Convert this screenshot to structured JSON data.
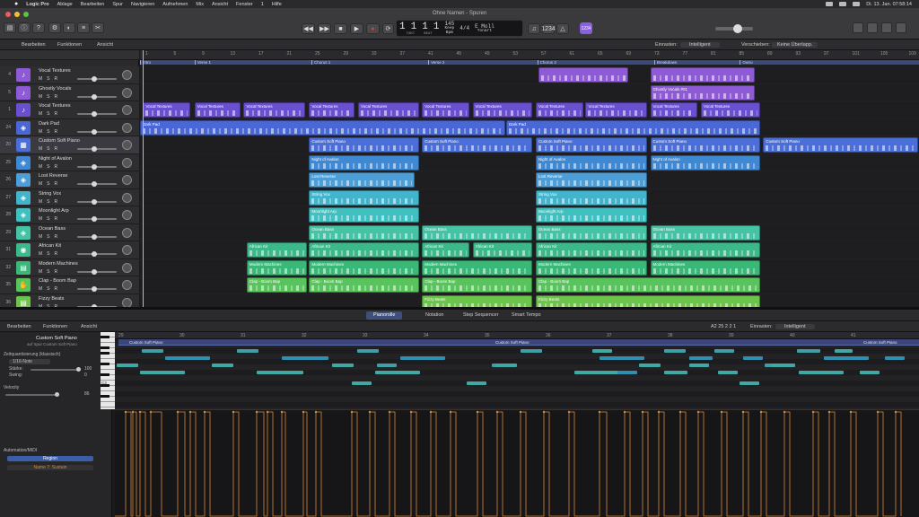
{
  "menubar": {
    "app": "Logic Pro",
    "items": [
      "Ablage",
      "Bearbeiten",
      "Spur",
      "Navigieren",
      "Aufnehmen",
      "Mix",
      "Ansicht",
      "Fenster",
      "1",
      "Hilfe"
    ],
    "clock": "Di. 13. Jan.  07:58:14"
  },
  "window": {
    "title": "Ohne Namen - Spuren"
  },
  "lcd": {
    "bar": "1",
    "beat": "1",
    "div": "1",
    "tick": "1",
    "bar_label": "TAKT",
    "beat_label": "BEAT",
    "tempo": "145",
    "tempo_label": "Bpm",
    "tempo_mode": "Keep",
    "signature": "4/4",
    "key": "E Moll",
    "key_label": "Tonart"
  },
  "smart_label": "1234",
  "arrange_bar": {
    "edit": "Bearbeiten",
    "functions": "Funktionen",
    "view": "Ansicht",
    "snap_label": "Einrasten:",
    "snap_value": "Intelligent",
    "drag_label": "Verschieben:",
    "drag_value": "Keine Überlapp."
  },
  "tracks": [
    {
      "num": "4",
      "name": "Vocal Textures",
      "color": "#8e5ad6",
      "icon": "♪"
    },
    {
      "num": "5",
      "name": "Ghostly Vocals",
      "color": "#8e5ad6",
      "icon": "♪"
    },
    {
      "num": "1",
      "name": "Vocal Textures",
      "color": "#6a4fd0",
      "icon": "♪"
    },
    {
      "num": "24",
      "name": "Dark Pad",
      "color": "#4a67d6",
      "icon": "◈"
    },
    {
      "num": "20",
      "name": "Custom Soft Piano",
      "color": "#4b6fd8",
      "icon": "▦"
    },
    {
      "num": "25",
      "name": "Night of Avalon",
      "color": "#3f88d4",
      "icon": "◈"
    },
    {
      "num": "26",
      "name": "Lost Reverse",
      "color": "#4d9ed6",
      "icon": "◈"
    },
    {
      "num": "27",
      "name": "String Vox",
      "color": "#42b4cc",
      "icon": "◈"
    },
    {
      "num": "28",
      "name": "Moonlight Arp",
      "color": "#40c0c0",
      "icon": "◈"
    },
    {
      "num": "29",
      "name": "Ocean Bass",
      "color": "#44c4a4",
      "icon": "◈"
    },
    {
      "num": "31",
      "name": "African Kit",
      "color": "#3cb88a",
      "icon": "◉"
    },
    {
      "num": "32",
      "name": "Modern Machines",
      "color": "#3ab878",
      "icon": "▤"
    },
    {
      "num": "35",
      "name": "Clap - Boom Bap",
      "color": "#58c45c",
      "icon": "✋"
    },
    {
      "num": "36",
      "name": "Fizzy Beats",
      "color": "#6cc44a",
      "icon": "▤"
    }
  ],
  "track_buttons": {
    "m": "M",
    "s": "S",
    "r": "R"
  },
  "ruler": [
    "1",
    "5",
    "9",
    "13",
    "17",
    "21",
    "25",
    "29",
    "33",
    "37",
    "41",
    "45",
    "49",
    "53",
    "57",
    "61",
    "65",
    "69",
    "73",
    "77",
    "81",
    "85",
    "89",
    "93",
    "97",
    "101",
    "105",
    "109"
  ],
  "markers": [
    {
      "label": "Intro",
      "start": 0.0,
      "end": 0.07
    },
    {
      "label": "Verse 1",
      "start": 0.07,
      "end": 0.22
    },
    {
      "label": "Chorus 1",
      "start": 0.22,
      "end": 0.37
    },
    {
      "label": "Verse 2",
      "start": 0.37,
      "end": 0.51
    },
    {
      "label": "Chorus 2",
      "start": 0.51,
      "end": 0.66
    },
    {
      "label": "Breakdown",
      "start": 0.66,
      "end": 0.77
    },
    {
      "label": "Outro",
      "start": 0.77,
      "end": 1.0
    }
  ],
  "regions": [
    {
      "lane": 0,
      "label": "",
      "start": 0.511,
      "end": 0.628
    },
    {
      "lane": 0,
      "label": "",
      "start": 0.655,
      "end": 0.79
    },
    {
      "lane": 1,
      "label": "Ghostly Vocals #01",
      "start": 0.655,
      "end": 0.79
    },
    {
      "lane": 2,
      "label": "Vocal Textures",
      "start": 0.004,
      "end": 0.066
    },
    {
      "lane": 2,
      "label": "Vocal Textures",
      "start": 0.07,
      "end": 0.13
    },
    {
      "lane": 2,
      "label": "Vocal Textures",
      "start": 0.133,
      "end": 0.213
    },
    {
      "lane": 2,
      "label": "Vocal Textures",
      "start": 0.217,
      "end": 0.276
    },
    {
      "lane": 2,
      "label": "Vocal Textures",
      "start": 0.28,
      "end": 0.36
    },
    {
      "lane": 2,
      "label": "Vocal Textures",
      "start": 0.362,
      "end": 0.424
    },
    {
      "lane": 2,
      "label": "Vocal Textures",
      "start": 0.427,
      "end": 0.505
    },
    {
      "lane": 2,
      "label": "Vocal Textures",
      "start": 0.508,
      "end": 0.57
    },
    {
      "lane": 2,
      "label": "Vocal Textures",
      "start": 0.572,
      "end": 0.652
    },
    {
      "lane": 2,
      "label": "Vocal Textures",
      "start": 0.655,
      "end": 0.717
    },
    {
      "lane": 2,
      "label": "Vocal Textures",
      "start": 0.72,
      "end": 0.797
    },
    {
      "lane": 3,
      "label": "Dark Pad",
      "start": 0.0,
      "end": 0.47
    },
    {
      "lane": 3,
      "label": "Dark Pad",
      "start": 0.47,
      "end": 0.797
    },
    {
      "lane": 4,
      "label": "Custom Soft Piano",
      "start": 0.217,
      "end": 0.36
    },
    {
      "lane": 4,
      "label": "Custom Soft Piano",
      "start": 0.362,
      "end": 0.505
    },
    {
      "lane": 4,
      "label": "Custom Soft Piano",
      "start": 0.508,
      "end": 0.652
    },
    {
      "lane": 4,
      "label": "Custom Soft Piano",
      "start": 0.655,
      "end": 0.797
    },
    {
      "lane": 4,
      "label": "Custom Soft Piano",
      "start": 0.8,
      "end": 1.0
    },
    {
      "lane": 5,
      "label": "Night of Avalon",
      "start": 0.217,
      "end": 0.36
    },
    {
      "lane": 5,
      "label": "Night of Avalon",
      "start": 0.508,
      "end": 0.652
    },
    {
      "lane": 5,
      "label": "Night of Avalon",
      "start": 0.655,
      "end": 0.797
    },
    {
      "lane": 6,
      "label": "Lost Reverse",
      "start": 0.217,
      "end": 0.354
    },
    {
      "lane": 6,
      "label": "Lost Reverse",
      "start": 0.508,
      "end": 0.652
    },
    {
      "lane": 7,
      "label": "String Vox",
      "start": 0.217,
      "end": 0.36
    },
    {
      "lane": 7,
      "label": "String Vox",
      "start": 0.508,
      "end": 0.652
    },
    {
      "lane": 8,
      "label": "Moonlight Arp",
      "start": 0.217,
      "end": 0.36
    },
    {
      "lane": 8,
      "label": "Moonlight Arp",
      "start": 0.508,
      "end": 0.652
    },
    {
      "lane": 9,
      "label": "Ocean Bass",
      "start": 0.217,
      "end": 0.36
    },
    {
      "lane": 9,
      "label": "Ocean Bass",
      "start": 0.362,
      "end": 0.505
    },
    {
      "lane": 9,
      "label": "Ocean Bass",
      "start": 0.508,
      "end": 0.652
    },
    {
      "lane": 9,
      "label": "Ocean Bass",
      "start": 0.655,
      "end": 0.797
    },
    {
      "lane": 10,
      "label": "African Kit",
      "start": 0.137,
      "end": 0.215
    },
    {
      "lane": 10,
      "label": "African Kit",
      "start": 0.217,
      "end": 0.36
    },
    {
      "lane": 10,
      "label": "African Kit",
      "start": 0.362,
      "end": 0.424
    },
    {
      "lane": 10,
      "label": "African Kit",
      "start": 0.427,
      "end": 0.505
    },
    {
      "lane": 10,
      "label": "African Kit",
      "start": 0.508,
      "end": 0.652
    },
    {
      "lane": 10,
      "label": "African Kit",
      "start": 0.655,
      "end": 0.797
    },
    {
      "lane": 11,
      "label": "Modern Machines",
      "start": 0.137,
      "end": 0.215
    },
    {
      "lane": 11,
      "label": "Modern Machines",
      "start": 0.217,
      "end": 0.36
    },
    {
      "lane": 11,
      "label": "Modern Machines",
      "start": 0.362,
      "end": 0.505
    },
    {
      "lane": 11,
      "label": "Modern Machines",
      "start": 0.508,
      "end": 0.652
    },
    {
      "lane": 11,
      "label": "Modern Machines",
      "start": 0.655,
      "end": 0.797
    },
    {
      "lane": 12,
      "label": "Clap - Boom Bap",
      "start": 0.137,
      "end": 0.215
    },
    {
      "lane": 12,
      "label": "Clap - Boom Bap",
      "start": 0.217,
      "end": 0.36
    },
    {
      "lane": 12,
      "label": "Clap - Boom Bap",
      "start": 0.362,
      "end": 0.505
    },
    {
      "lane": 12,
      "label": "Clap - Boom Bap",
      "start": 0.508,
      "end": 0.797
    },
    {
      "lane": 13,
      "label": "Fizzy Beats",
      "start": 0.362,
      "end": 0.505
    },
    {
      "lane": 13,
      "label": "Fizzy Beats",
      "start": 0.508,
      "end": 0.797
    }
  ],
  "editor_tabs": [
    "Pianorolle",
    "Notation",
    "Step Sequencer",
    "Smart Tempo"
  ],
  "editor_bar": {
    "edit": "Bearbeiten",
    "functions": "Funktionen",
    "view": "Ansicht",
    "position": "A2  25 2 2 1",
    "snap_label": "Einrasten:",
    "snap_value": "Intelligent"
  },
  "inspector": {
    "region_name": "Custom Soft Piano",
    "region_sub": "auf Spur Custom Soft Piano",
    "quantize_header": "Zeitquantisierung (klassisch)",
    "quantize_value": "1/16-Note",
    "strength_label": "Stärke:",
    "strength_value": "100",
    "swing_label": "Swing:",
    "swing_value": "0",
    "velocity_label": "Velocity",
    "velocity_value": "86",
    "automation_label": "Automation/MIDI",
    "automation_mode": "Region",
    "automation_param": "Name 7: Sustain"
  },
  "roll_ruler": [
    "29",
    "30",
    "31",
    "32",
    "33",
    "34",
    "35",
    "36",
    "37",
    "38",
    "39",
    "40",
    "41"
  ],
  "roll_region_labels": [
    "Custom Soft Piano",
    "Custom Soft Piano",
    "Custom Soft Piano"
  ],
  "c3_label": "C3",
  "colors": {
    "accent": "#4a6fd8",
    "region_blue": "#3c4678",
    "automation": "#d5893a",
    "record": "#e03a3a",
    "smart": "#8a5fe0"
  }
}
